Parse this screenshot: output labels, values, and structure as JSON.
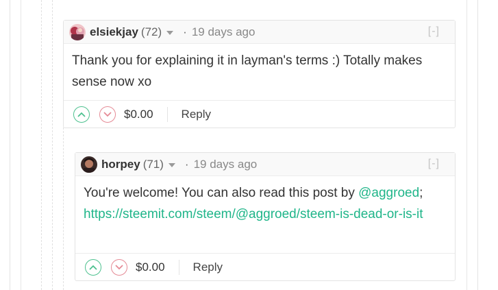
{
  "comments": [
    {
      "author": "elsiekjay",
      "reputation": "(72)",
      "separator": "·",
      "timestamp": "19 days ago",
      "collapse_label": "[-]",
      "body": "Thank you for explaining it in layman's terms :) Totally makes sense now xo",
      "payout": "$0.00",
      "reply_label": "Reply"
    },
    {
      "author": "horpey",
      "reputation": "(71)",
      "separator": "·",
      "timestamp": "19 days ago",
      "collapse_label": "[-]",
      "body_prefix": "You're welcome! You can also read this post by ",
      "mention": "@aggroed",
      "body_mid": ";",
      "link": "https://steemit.com/steem/@aggroed/steem-is-dead-or-is-it",
      "payout": "$0.00",
      "reply_label": "Reply"
    }
  ],
  "colors": {
    "link": "#1fb589",
    "upvote": "#4cc08e",
    "downvote": "#e58a95"
  }
}
